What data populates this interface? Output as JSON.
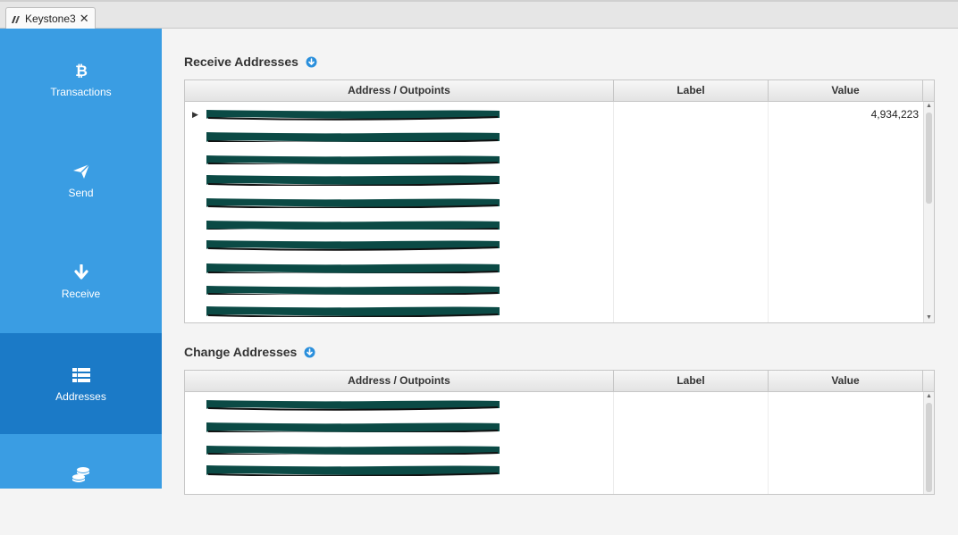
{
  "tab": {
    "title": "Keystone3",
    "close": "✕"
  },
  "sidebar": {
    "items": [
      {
        "label": "Transactions",
        "icon": "bitcoin-icon"
      },
      {
        "label": "Send",
        "icon": "paper-plane-icon"
      },
      {
        "label": "Receive",
        "icon": "arrow-down-icon"
      },
      {
        "label": "Addresses",
        "icon": "list-icon",
        "active": true
      },
      {
        "label": "",
        "icon": "coins-icon"
      }
    ]
  },
  "receive": {
    "title": "Receive Addresses",
    "columns": {
      "address": "Address / Outpoints",
      "label": "Label",
      "value": "Value"
    },
    "rows": [
      {
        "value": "4,934,223",
        "expandable": true
      },
      {
        "value": ""
      },
      {
        "value": ""
      },
      {
        "value": ""
      },
      {
        "value": ""
      },
      {
        "value": ""
      },
      {
        "value": ""
      },
      {
        "value": ""
      },
      {
        "value": ""
      },
      {
        "value": ""
      }
    ]
  },
  "change": {
    "title": "Change Addresses",
    "columns": {
      "address": "Address / Outpoints",
      "label": "Label",
      "value": "Value"
    },
    "rows": [
      {
        "value": ""
      },
      {
        "value": ""
      },
      {
        "value": ""
      },
      {
        "value": ""
      }
    ]
  },
  "colors": {
    "sidebar": "#3a9de3",
    "sidebar_active": "#1b7ac7",
    "accent": "#2a8fdc",
    "redaction": "#0b4a45"
  }
}
